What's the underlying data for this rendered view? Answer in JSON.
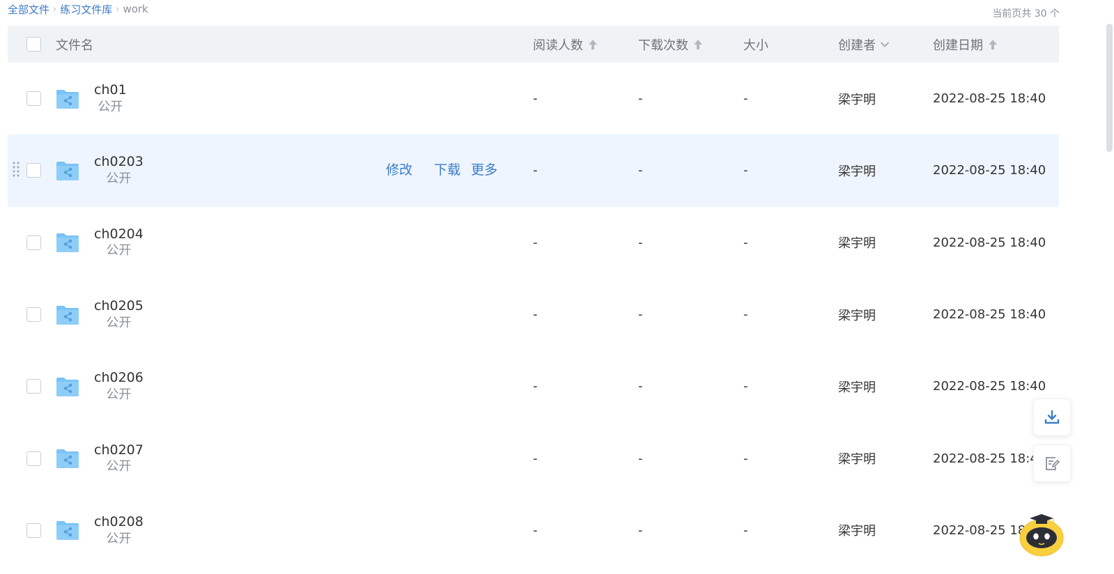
{
  "breadcrumb": {
    "items": [
      "全部文件",
      "练习文件库"
    ],
    "current": "work"
  },
  "page_count": "当前页共 30 个",
  "columns": {
    "name": "文件名",
    "readers": "阅读人数",
    "downloads": "下载次数",
    "size": "大小",
    "creator": "创建者",
    "date": "创建日期"
  },
  "row_actions": {
    "edit": "修改",
    "download": "下载",
    "more": "更多"
  },
  "rows": [
    {
      "name": "ch01",
      "visibility": "公开",
      "readers": "-",
      "downloads": "-",
      "size": "-",
      "creator": "梁宇明",
      "date": "2022-08-25 18:40"
    },
    {
      "name": "ch0203",
      "visibility": "公开",
      "readers": "-",
      "downloads": "-",
      "size": "-",
      "creator": "梁宇明",
      "date": "2022-08-25 18:40"
    },
    {
      "name": "ch0204",
      "visibility": "公开",
      "readers": "-",
      "downloads": "-",
      "size": "-",
      "creator": "梁宇明",
      "date": "2022-08-25 18:40"
    },
    {
      "name": "ch0205",
      "visibility": "公开",
      "readers": "-",
      "downloads": "-",
      "size": "-",
      "creator": "梁宇明",
      "date": "2022-08-25 18:40"
    },
    {
      "name": "ch0206",
      "visibility": "公开",
      "readers": "-",
      "downloads": "-",
      "size": "-",
      "creator": "梁宇明",
      "date": "2022-08-25 18:40"
    },
    {
      "name": "ch0207",
      "visibility": "公开",
      "readers": "-",
      "downloads": "-",
      "size": "-",
      "creator": "梁宇明",
      "date": "2022-08-25 18:40"
    },
    {
      "name": "ch0208",
      "visibility": "公开",
      "readers": "-",
      "downloads": "-",
      "size": "-",
      "creator": "梁宇明",
      "date": "2022-08-25 18:40"
    }
  ],
  "colors": {
    "accent": "#3a7cc9",
    "folder": "#7cc3f5",
    "row_hover": "#eef5fe",
    "header_bg": "#f0f3f6"
  },
  "icons": {
    "folder": "shared-folder-icon",
    "download": "download-icon",
    "note": "note-icon",
    "assistant": "assistant-mascot-icon"
  }
}
